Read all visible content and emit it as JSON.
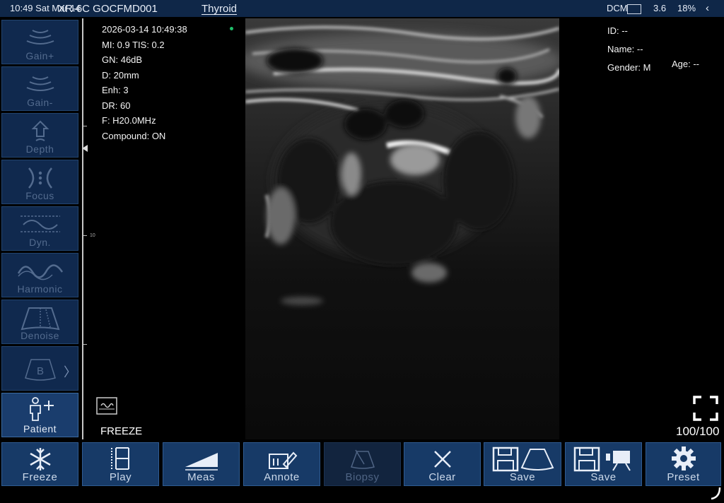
{
  "status_bar": {
    "time": "10:49",
    "date": "Sat Mar 14",
    "device": "XR-6C GOCFMD001",
    "preset": "Thyroid",
    "dcm": "DCM",
    "freq": "3.6",
    "battery": "18%",
    "back_icon": "chevron-left-icon"
  },
  "left_toolbar": [
    {
      "label": "Gain+",
      "icon": "gain-up-icon"
    },
    {
      "label": "Gain-",
      "icon": "gain-down-icon"
    },
    {
      "label": "Depth",
      "icon": "depth-icon"
    },
    {
      "label": "Focus",
      "icon": "focus-icon"
    },
    {
      "label": "Dyn.",
      "icon": "dynamic-range-icon"
    },
    {
      "label": "Harmonic",
      "icon": "harmonic-icon"
    },
    {
      "label": "Denoise",
      "icon": "denoise-icon"
    },
    {
      "label": "B",
      "icon": "b-mode-icon"
    },
    {
      "label": "Patient",
      "icon": "patient-icon"
    }
  ],
  "depth_scale": {
    "label": "10"
  },
  "image_info": {
    "datetime": "2026-03-14 10:49:38",
    "mi_tis": "MI: 0.9  TIS: 0.2",
    "gain": "GN: 46dB",
    "depth": "D: 20mm",
    "enhance": "Enh: 3",
    "dynamic_range": "DR: 60",
    "frequency": "F: H20.0MHz",
    "compound": "Compound: ON"
  },
  "patient": {
    "id": "ID: --",
    "name": "Name: --",
    "gender": "Gender: M",
    "age": "Age: --"
  },
  "freeze_status": "FREEZE",
  "frame_count": "100/100",
  "bottom_toolbar": [
    {
      "label": "Freeze",
      "icon": "snowflake-icon"
    },
    {
      "label": "Play",
      "icon": "play-icon"
    },
    {
      "label": "Meas",
      "icon": "measure-icon"
    },
    {
      "label": "Annote",
      "icon": "annotate-icon"
    },
    {
      "label": "Biopsy",
      "icon": "biopsy-icon"
    },
    {
      "label": "Clear",
      "icon": "clear-icon"
    },
    {
      "label": "Save",
      "icon": "save-image-icon"
    },
    {
      "label": "Save",
      "icon": "save-video-icon"
    },
    {
      "label": "Preset",
      "icon": "gear-icon"
    }
  ],
  "colors": {
    "status_bar": "#0f2748",
    "tool_bg": "#173a67",
    "tool_disabled": "#12243e",
    "accent_dot": "#1fbf6a"
  }
}
